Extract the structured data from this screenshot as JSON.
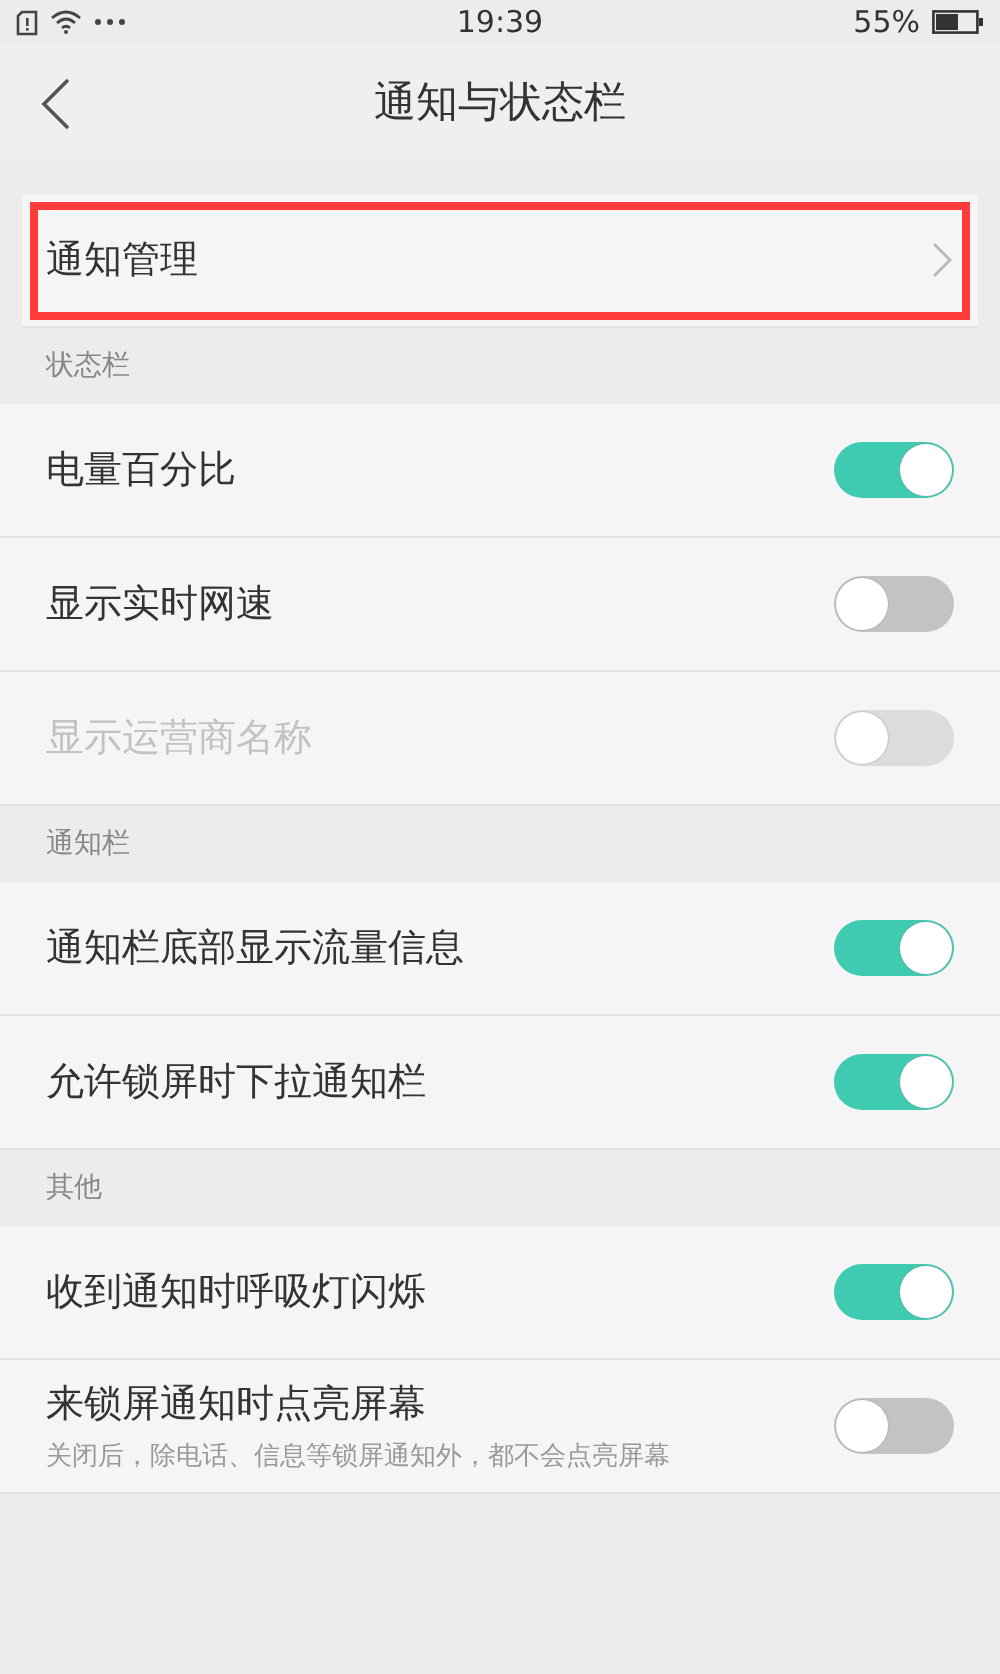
{
  "status_bar": {
    "time": "19:39",
    "battery_text": "55%"
  },
  "header": {
    "title": "通知与状态栏"
  },
  "sections": [
    {
      "items": [
        {
          "kind": "link",
          "label": "通知管理",
          "highlighted": true
        }
      ]
    },
    {
      "title": "状态栏",
      "items": [
        {
          "kind": "toggle",
          "label": "电量百分比",
          "on": true,
          "disabled": false
        },
        {
          "kind": "toggle",
          "label": "显示实时网速",
          "on": false,
          "disabled": false
        },
        {
          "kind": "toggle",
          "label": "显示运营商名称",
          "on": false,
          "disabled": true
        }
      ]
    },
    {
      "title": "通知栏",
      "items": [
        {
          "kind": "toggle",
          "label": "通知栏底部显示流量信息",
          "on": true,
          "disabled": false
        },
        {
          "kind": "toggle",
          "label": "允许锁屏时下拉通知栏",
          "on": true,
          "disabled": false
        }
      ]
    },
    {
      "title": "其他",
      "items": [
        {
          "kind": "toggle",
          "label": "收到通知时呼吸灯闪烁",
          "on": true,
          "disabled": false
        },
        {
          "kind": "toggle",
          "label": "来锁屏通知时点亮屏幕",
          "description": "关闭后，除电话、信息等锁屏通知外，都不会点亮屏幕",
          "on": false,
          "disabled": false
        }
      ]
    }
  ]
}
